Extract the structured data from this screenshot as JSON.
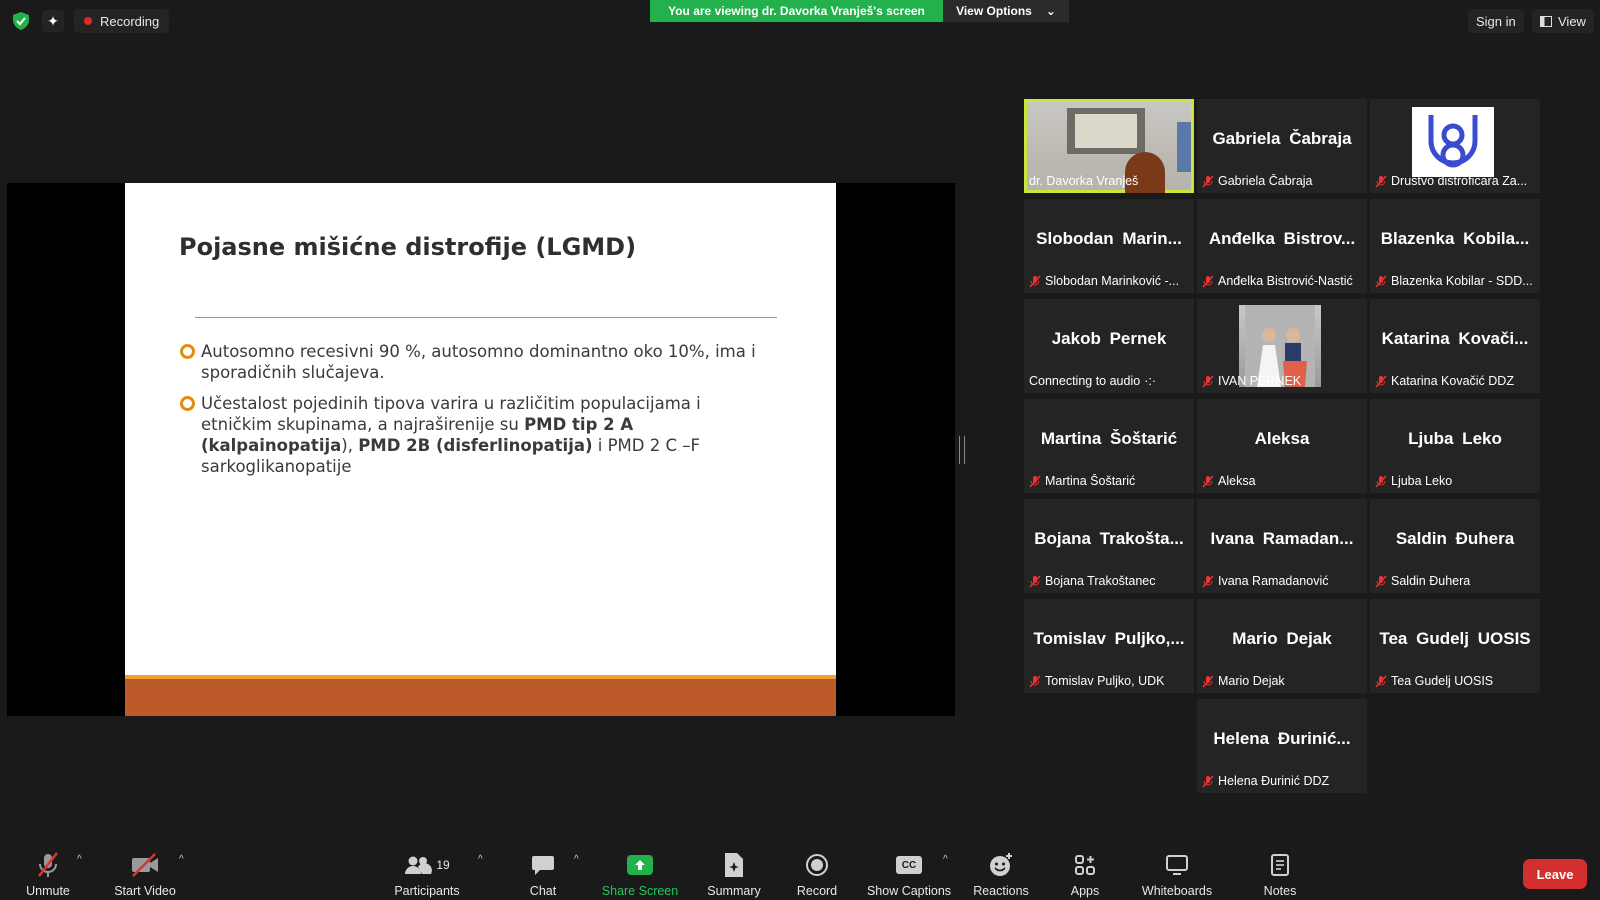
{
  "topbar": {
    "recording_label": "Recording",
    "viewing_banner": "You are viewing dr. Davorka Vranješ's screen",
    "view_options_label": "View Options",
    "sign_in_label": "Sign in",
    "view_label": "View"
  },
  "slide": {
    "title": "Pojasne mišićne distrofije (LGMD)",
    "bullet1": "Autosomno recesivni 90 %, autosomno dominantno oko 10%, ima i sporadičnih slučajeva.",
    "bullet2": {
      "part1": "Učestalost pojedinih tipova varira u različitim populacijama i etničkim skupinama, a najraširenije su ",
      "bold1": "PMD tip 2 A (kalpainopatija",
      "part2": "), ",
      "bold2": "PMD 2B (disferlinopatija)",
      "part3": "  i PMD 2 C –F sarkoglikanopatije"
    }
  },
  "gallery": {
    "tiles": [
      {
        "big": "",
        "label": "dr. Davorka Vranješ"
      },
      {
        "big": "Gabriela Čabraja",
        "label": "Gabriela Čabraja"
      },
      {
        "big": "",
        "label": "Drustvo distroficara Za..."
      },
      {
        "big": "Slobodan Marin...",
        "label": "Slobodan Marinković -..."
      },
      {
        "big": "Anđelka Bistrov...",
        "label": "Anđelka Bistrović-Nastić"
      },
      {
        "big": "Blazenka Kobila...",
        "label": "Blazenka Kobilar - SDD..."
      },
      {
        "big": "Jakob Pernek",
        "label": "Connecting to audio"
      },
      {
        "big": "",
        "label": "IVAN PERNEK"
      },
      {
        "big": "Katarina Kovači...",
        "label": "Katarina Kovačić DDZ"
      },
      {
        "big": "Martina Šoštarić",
        "label": "Martina Šoštarić"
      },
      {
        "big": "Aleksa",
        "label": "Aleksa"
      },
      {
        "big": "Ljuba Leko",
        "label": "Ljuba Leko"
      },
      {
        "big": "Bojana Trakošta...",
        "label": "Bojana Trakoštanec"
      },
      {
        "big": "Ivana Ramadan...",
        "label": "Ivana Ramadanović"
      },
      {
        "big": "Saldin Đuhera",
        "label": "Saldin Đuhera"
      },
      {
        "big": "Tomislav Puljko,...",
        "label": "Tomislav Puljko, UDK"
      },
      {
        "big": "Mario Dejak",
        "label": "Mario Dejak"
      },
      {
        "big": "Tea Gudelj UOSIS",
        "label": "Tea Gudelj UOSIS"
      },
      {
        "big": "Helena Đurinić...",
        "label": "Helena Đurinić DDZ"
      }
    ]
  },
  "toolbar": {
    "unmute": "Unmute",
    "start_video": "Start Video",
    "participants": "Participants",
    "participants_count": "19",
    "chat": "Chat",
    "share_screen": "Share Screen",
    "summary": "Summary",
    "record": "Record",
    "show_captions": "Show Captions",
    "cc": "CC",
    "reactions": "Reactions",
    "apps": "Apps",
    "whiteboards": "Whiteboards",
    "notes": "Notes",
    "leave": "Leave"
  },
  "colors": {
    "accent_green": "#22b14c",
    "active_speaker": "#c8e63c",
    "leave_red": "#d32f2f",
    "slide_orange": "#bc5a2a"
  }
}
